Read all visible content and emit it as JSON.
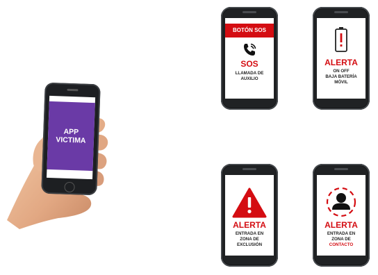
{
  "app_phone": {
    "screen_line1": "APP",
    "screen_line2": "VICTIMA"
  },
  "cards": {
    "sos": {
      "header": "BOTÓN SOS",
      "icon": "phone-call-icon",
      "title": "SOS",
      "sub_line1": "LLAMADA DE",
      "sub_line2": "AUXILIO"
    },
    "battery": {
      "icon": "low-battery-icon",
      "title": "ALERTA",
      "sub_line1": "ON OFF",
      "sub_line2": "BAJA BATERÍA",
      "sub_line3": "MÓVIL"
    },
    "exclusion": {
      "icon": "warning-triangle-icon",
      "title": "ALERTA",
      "sub_line1": "ENTRADA EN",
      "sub_line2": "ZONA DE",
      "sub_line3": "EXCLUSIÓN"
    },
    "contact": {
      "icon": "person-zone-icon",
      "title": "ALERTA",
      "sub_line1": "ENTRADA EN",
      "sub_line2": "ZONA DE",
      "sub_line3": "CONTACTO"
    }
  },
  "colors": {
    "alert_red": "#d40d12",
    "app_purple": "#6a3aa6",
    "phone_body": "#202224"
  }
}
